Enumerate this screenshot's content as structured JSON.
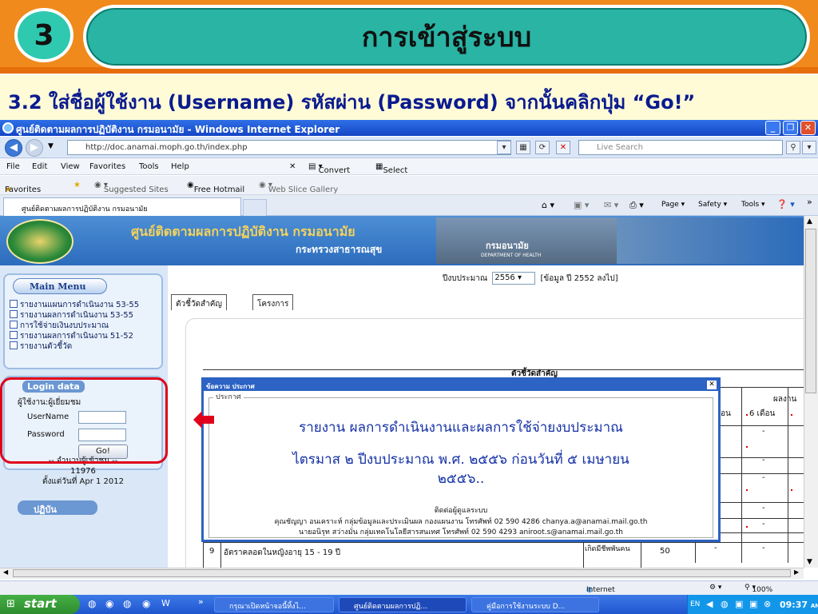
{
  "slide": {
    "step_number": "3",
    "title": "การเข้าสู่ระบบ",
    "instruction": "3.2 ใส่ชื่อผู้ใช้งาน (Username) รหัสผ่าน (Password) จากนั้นคลิกปุ่ม “Go!”"
  },
  "browser": {
    "window_title": "ศูนย์ติดตามผลการปฏิบัติงาน กรมอนามัย - Windows Internet Explorer",
    "url": "http://doc.anamai.moph.go.th/index.php",
    "search_placeholder": "Live Search",
    "menu": [
      "File",
      "Edit",
      "View",
      "Favorites",
      "Tools",
      "Help"
    ],
    "toolbar_convert": "Convert",
    "toolbar_select": "Select",
    "favorites_label": "Favorites",
    "favorites_links": [
      "Suggested Sites",
      "Free Hotmail",
      "Web Slice Gallery"
    ],
    "tab_title": "ศูนย์ติดตามผลการปฏิบัติงาน กรมอนามัย",
    "command_bar": [
      "Page",
      "Safety",
      "Tools"
    ],
    "status_zone": "Internet",
    "zoom": "100%"
  },
  "site": {
    "name": "ศูนย์ติดตามผลการปฏิบัติงาน  กรมอนามัย",
    "ministry": "กระทรวงสาธารณสุข",
    "banner_photo_text": "กรมอนามัย",
    "banner_photo_sub": "DEPARTMENT OF HEALTH",
    "main_menu_title": "Main Menu",
    "menu_items": [
      "รายงานแผนการดำเนินงาน 53-55",
      "รายงานผลการดำเนินงาน 53-55",
      "การใช้จ่ายเงินงบประมาณ",
      "รายงานผลการดำเนินงาน 51-52",
      "รายงานตัวชี้วัด"
    ],
    "login": {
      "title": "Login data",
      "user_caption": "ผู้ใช้งาน:ผู้เยี่ยมชม",
      "username_label": "UserName",
      "password_label": "Password",
      "go_label": "Go!"
    },
    "visitor": {
      "line1": "-- จำนวนผู้เข้าชม --",
      "count": "11976",
      "since": "ตั้งแต่วันที่ Apr 1 2012"
    },
    "performance_title": "ปฏิบัน",
    "year_label": "ปีงบประมาณ",
    "year_value": "2556",
    "year_note": "[ข้อมูล ปี 2552 ลงไป]",
    "tabs": [
      "ตัวชี้วัดสำคัญ",
      "โครงการ"
    ],
    "table_caption": "ตัวชี้วัดสำคัญ",
    "table_header_result": "ผลงาน",
    "table_header_6m": "6 เดือน",
    "table_header_3m": "อน",
    "row9": {
      "no": "9",
      "name": "อัตราคลอดในหญิงอายุ 15 - 19 ปี",
      "unit": "เกิดมีชีพพันคน",
      "target": "50",
      "v1": "-",
      "v2": "-"
    },
    "dash": "-"
  },
  "popup": {
    "title": "ข้อความ ประกาศ",
    "group_label": "ประกาศ",
    "line1": "รายงาน ผลการดำเนินงานและผลการใช้จ่ายงบประมาณ",
    "line2": "ไตรมาส ๒ ปีงบประมาณ พ.ศ. ๒๕๕๖  ก่อนวันที่ ๕ เมษายน",
    "line3": "๒๕๕๖..",
    "contact_title": "ติดต่อผู้ดูแลระบบ",
    "contact_1": "คุณชัญญา อนเคราะห์ กลุ่มข้อมูลและประเมินผล กองแผนงาน โทรศัพท์ 02 590 4286 chanya.a@anamai.mail.go.th",
    "contact_2": "นายอนิรุท สว่างมั่น กลุ่มเทคโนโลยีสารสนเทศ โทรศัพท์ 02 590 4293 aniroot.s@anamai.mail.go.th"
  },
  "taskbar": {
    "start": "start",
    "tasks": [
      "กรุณาเปิดหน้าจอนี้ทิ้งไ...",
      "ศูนย์ติดตามผลการปฏิ...",
      "คู่มือการใช้งานระบบ D..."
    ],
    "lang": "EN",
    "clock": "09:37",
    "clock_ampm": "AM"
  },
  "colors": {
    "slide_orange": "#f08a1c",
    "title_teal": "#29b4a4",
    "instruction_blue": "#0a1a8f",
    "highlight_red": "#e0001b",
    "xp_blue": "#1f55cf"
  }
}
